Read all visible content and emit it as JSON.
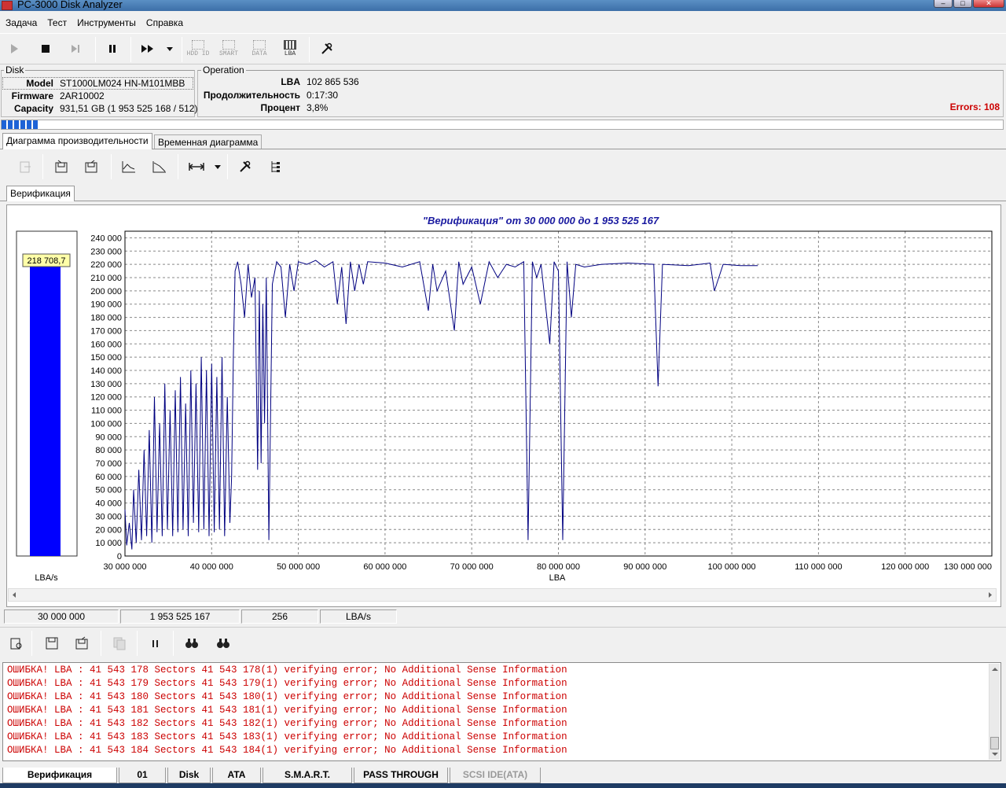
{
  "window": {
    "title": "PC-3000 Disk Analyzer"
  },
  "menu": [
    "Задача",
    "Тест",
    "Инструменты",
    "Справка"
  ],
  "toolbar": {
    "labels": [
      "HDD ID",
      "SMART",
      "DATA",
      "LBA"
    ]
  },
  "disk": {
    "group_label": "Disk",
    "model_label": "Model",
    "model": "ST1000LM024 HN-M101MBB",
    "firmware_label": "Firmware",
    "firmware": "2AR10002",
    "capacity_label": "Capacity",
    "capacity": "931,51 GB (1 953 525 168 / 512)"
  },
  "operation": {
    "group_label": "Operation",
    "lba_label": "LBA",
    "lba": "102 865 536",
    "duration_label": "Продолжительность",
    "duration": "0:17:30",
    "percent_label": "Процент",
    "percent": "3,8%",
    "progress": 0.038,
    "errors": "Errors: 108"
  },
  "tabs": [
    "Диаграмма производительности",
    "Временная диаграмма"
  ],
  "subtab": "Верификация",
  "gauge": {
    "value": "218 708,7",
    "numeric": 218708.7,
    "max": 245000,
    "unit": "LBA/s"
  },
  "chart_data": {
    "type": "line",
    "title": "\"Верификация\" от 30 000 000 до 1 953 525 167",
    "xlabel": "LBA",
    "ylabel": "",
    "xlim": [
      30000000,
      130000000
    ],
    "ylim": [
      0,
      245000
    ],
    "xticks": [
      "30 000 000",
      "40 000 000",
      "50 000 000",
      "60 000 000",
      "70 000 000",
      "80 000 000",
      "90 000 000",
      "100 000 000",
      "110 000 000",
      "120 000 000",
      "130 000 000"
    ],
    "yticks": [
      "0",
      "10 000",
      "20 000",
      "30 000",
      "40 000",
      "50 000",
      "60 000",
      "70 000",
      "80 000",
      "90 000",
      "100 000",
      "110 000",
      "120 000",
      "130 000",
      "140 000",
      "150 000",
      "160 000",
      "170 000",
      "180 000",
      "190 000",
      "200 000",
      "210 000",
      "220 000",
      "230 000",
      "240 000"
    ],
    "grid": true,
    "series": [
      {
        "color": "#000080",
        "x": [
          30000000,
          30200000,
          30500000,
          30800000,
          31000000,
          31300000,
          31600000,
          31900000,
          32200000,
          32500000,
          32800000,
          33100000,
          33400000,
          33700000,
          34000000,
          34300000,
          34600000,
          34900000,
          35200000,
          35500000,
          35800000,
          36100000,
          36400000,
          36700000,
          37000000,
          37300000,
          37600000,
          37900000,
          38200000,
          38500000,
          38800000,
          39100000,
          39400000,
          39700000,
          40000000,
          40300000,
          40600000,
          40900000,
          41200000,
          41500000,
          41800000,
          42100000,
          42300000,
          42500000,
          42700000,
          43000000,
          43400000,
          43800000,
          44200000,
          44600000,
          45000000,
          45300000,
          45500000,
          45700000,
          45900000,
          46100000,
          46300000,
          46600000,
          47000000,
          47500000,
          48000000,
          48500000,
          49000000,
          49500000,
          50000000,
          51000000,
          52000000,
          53000000,
          54000000,
          54500000,
          55000000,
          55500000,
          56000000,
          56500000,
          57000000,
          57500000,
          58000000,
          60000000,
          62000000,
          64000000,
          65000000,
          65500000,
          66000000,
          67000000,
          68000000,
          68500000,
          69000000,
          70000000,
          71000000,
          72000000,
          73000000,
          74000000,
          75000000,
          76000000,
          76500000,
          77000000,
          77500000,
          78000000,
          79000000,
          79500000,
          80000000,
          80500000,
          81000000,
          81500000,
          82000000,
          83000000,
          85000000,
          88000000,
          91000000,
          91500000,
          92000000,
          95000000,
          97500000,
          98000000,
          99000000,
          101000000,
          103000000
        ],
        "y": [
          35000,
          8000,
          25000,
          5000,
          50000,
          10000,
          65000,
          12000,
          80000,
          15000,
          95000,
          10000,
          120000,
          18000,
          100000,
          15000,
          130000,
          20000,
          110000,
          15000,
          125000,
          18000,
          135000,
          20000,
          115000,
          15000,
          140000,
          25000,
          130000,
          18000,
          150000,
          20000,
          140000,
          15000,
          145000,
          18000,
          135000,
          20000,
          150000,
          15000,
          120000,
          25000,
          60000,
          150000,
          215000,
          222000,
          205000,
          180000,
          220000,
          195000,
          210000,
          65000,
          200000,
          70000,
          190000,
          100000,
          210000,
          12000,
          205000,
          222000,
          218000,
          180000,
          220000,
          200000,
          222000,
          220000,
          223000,
          218000,
          222000,
          190000,
          218000,
          175000,
          222000,
          200000,
          220000,
          205000,
          222000,
          221000,
          218000,
          222000,
          185000,
          220000,
          200000,
          215000,
          170000,
          222000,
          205000,
          218000,
          190000,
          222000,
          210000,
          220000,
          218000,
          222000,
          12000,
          222000,
          210000,
          220000,
          160000,
          222000,
          215000,
          12000,
          222000,
          180000,
          220000,
          218000,
          220000,
          221000,
          220000,
          128000,
          220000,
          219000,
          221000,
          200000,
          220000,
          219000,
          219000
        ]
      }
    ]
  },
  "statusbar": [
    "30 000 000",
    "1 953 525 167",
    "256",
    "LBA/s"
  ],
  "log": [
    "ОШИБКА! LBA : 41 543 178 Sectors 41 543 178(1) verifying error; No Additional Sense Information",
    "ОШИБКА! LBA : 41 543 179 Sectors 41 543 179(1) verifying error; No Additional Sense Information",
    "ОШИБКА! LBA : 41 543 180 Sectors 41 543 180(1) verifying error; No Additional Sense Information",
    "ОШИБКА! LBA : 41 543 181 Sectors 41 543 181(1) verifying error; No Additional Sense Information",
    "ОШИБКА! LBA : 41 543 182 Sectors 41 543 182(1) verifying error; No Additional Sense Information",
    "ОШИБКА! LBA : 41 543 183 Sectors 41 543 183(1) verifying error; No Additional Sense Information",
    "ОШИБКА! LBA : 41 543 184 Sectors 41 543 184(1) verifying error; No Additional Sense Information"
  ],
  "bottom_tabs": [
    "Верификация",
    "01",
    "Disk",
    "ATA",
    "S.M.A.R.T.",
    "PASS THROUGH",
    "SCSI IDE(ATA)"
  ]
}
